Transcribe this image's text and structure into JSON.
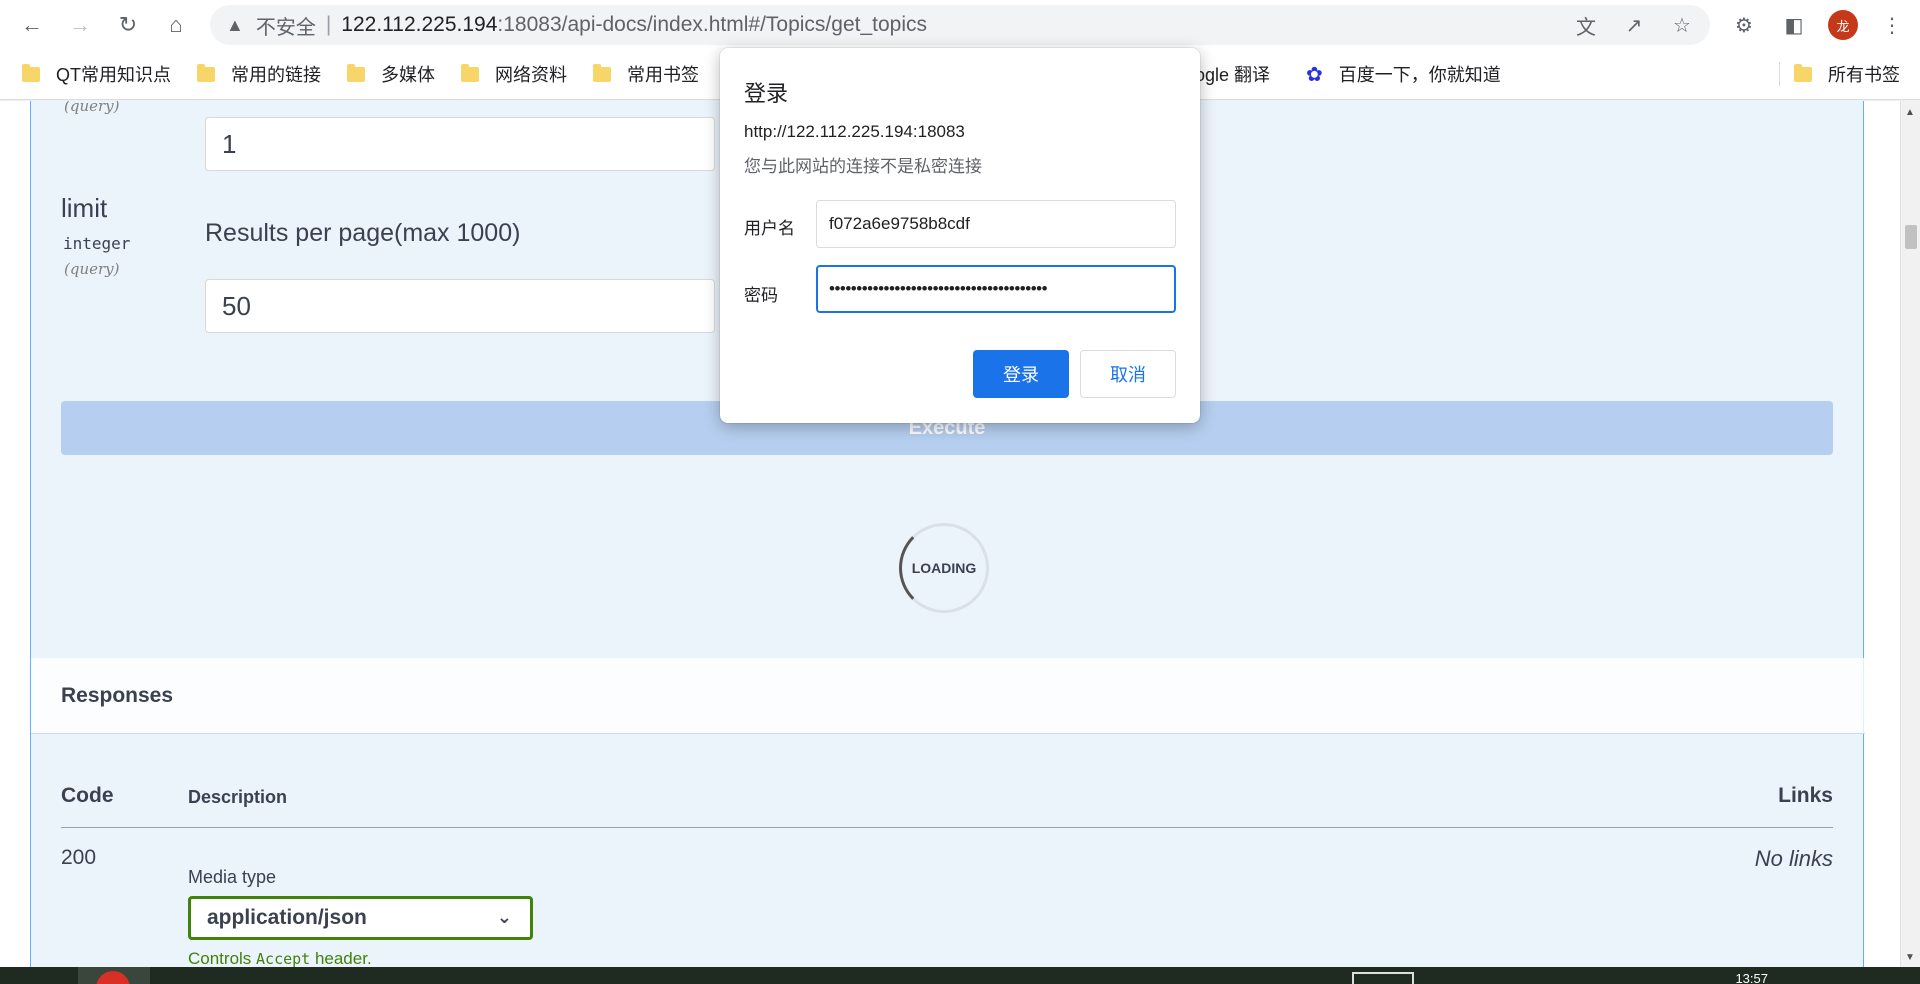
{
  "browser": {
    "url_insecure": "不安全",
    "url_host": "122.112.225.194",
    "url_rest": ":18083/api-docs/index.html#/Topics/get_topics",
    "avatar_text": "龙",
    "bookmarks": [
      "QT常用知识点",
      "常用的链接",
      "多媒体",
      "网络资料",
      "常用书签"
    ],
    "bookmark_translate": "ogle 翻译",
    "bookmark_baidu": "百度一下，你就知道",
    "bookmark_all": "所有书签"
  },
  "params": {
    "page_query": "(query)",
    "page_value": "1",
    "limit_name": "limit",
    "limit_type": "integer",
    "limit_query": "(query)",
    "limit_desc": "Results per page(max 1000)",
    "limit_value": "50"
  },
  "execute_label": "Execute",
  "loading_label": "LOADING",
  "responses": {
    "title": "Responses",
    "col_code": "Code",
    "col_description": "Description",
    "col_links": "Links",
    "rows": [
      {
        "code": "200",
        "media_type_label": "Media type",
        "media_type": "application/json",
        "controls_prefix": "Controls ",
        "controls_code": "Accept",
        "controls_suffix": " header.",
        "links": "No links"
      }
    ]
  },
  "dialog": {
    "title": "登录",
    "url": "http://122.112.225.194:18083",
    "note": "您与此网站的连接不是私密连接",
    "username_label": "用户名",
    "username_value": "f072a6e9758b8cdf",
    "password_label": "密码",
    "password_value": "••••••••••••••••••••••••••••••••••••••••",
    "login_label": "登录",
    "cancel_label": "取消"
  },
  "taskbar": {
    "clock": "13:57"
  },
  "colors": {
    "accent_blue": "#1a73e8",
    "get_blue": "#61affe",
    "media_green": "#41820b",
    "avatar_red": "#c5391a"
  }
}
